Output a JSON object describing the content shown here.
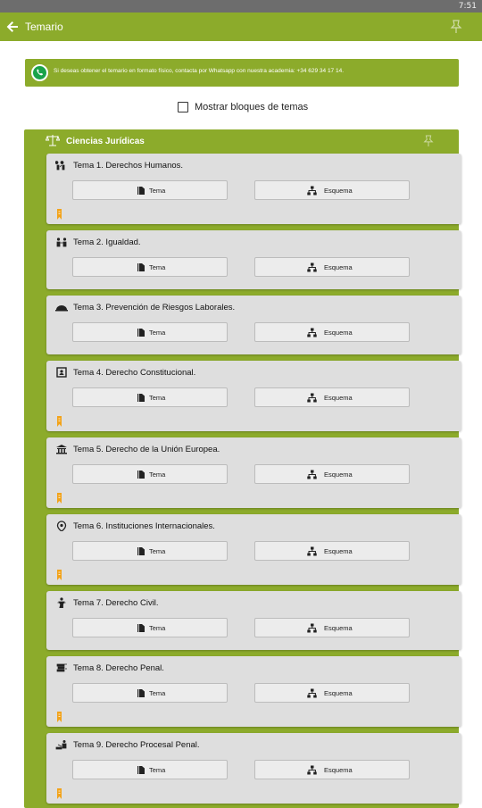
{
  "status": {
    "time": "7:51"
  },
  "appbar": {
    "title": "Temario",
    "back_icon": "arrow-left-icon",
    "pin_icon": "pin-icon"
  },
  "banner": {
    "text": "Si deseas obtener el temario en formato físico, contacta por Whatsapp con nuestra academia: +34 629 34 17 14.",
    "icon": "whatsapp-icon"
  },
  "toggle": {
    "label": "Mostrar bloques de temas",
    "checked": false
  },
  "block": {
    "title": "Ciencias Jurídicas",
    "icon": "scale-icon",
    "topics": [
      {
        "title": "Tema 1. Derechos Humanos.",
        "icon": "people-icon",
        "tema_label": "Tema",
        "esquema_label": "Esquema",
        "marked": true
      },
      {
        "title": "Tema 2. Igualdad.",
        "icon": "equality-icon",
        "tema_label": "Tema",
        "esquema_label": "Esquema",
        "marked": false
      },
      {
        "title": "Tema 3. Prevención de Riesgos Laborales.",
        "icon": "hardhat-icon",
        "tema_label": "Tema",
        "esquema_label": "Esquema",
        "marked": false
      },
      {
        "title": "Tema 4. Derecho Constitucional.",
        "icon": "book-icon",
        "tema_label": "Tema",
        "esquema_label": "Esquema",
        "marked": true
      },
      {
        "title": "Tema 5. Derecho de la Unión Europea.",
        "icon": "institution-icon",
        "tema_label": "Tema",
        "esquema_label": "Esquema",
        "marked": true
      },
      {
        "title": "Tema 6. Instituciones Internacionales.",
        "icon": "globe-pin-icon",
        "tema_label": "Tema",
        "esquema_label": "Esquema",
        "marked": true
      },
      {
        "title": "Tema 7. Derecho Civil.",
        "icon": "person-icon",
        "tema_label": "Tema",
        "esquema_label": "Esquema",
        "marked": false
      },
      {
        "title": "Tema 8. Derecho Penal.",
        "icon": "gavel-icon",
        "tema_label": "Tema",
        "esquema_label": "Esquema",
        "marked": true
      },
      {
        "title": "Tema 9. Derecho Procesal Penal.",
        "icon": "justice-icon",
        "tema_label": "Tema",
        "esquema_label": "Esquema",
        "marked": true
      }
    ]
  },
  "colors": {
    "primary": "#8cab2b",
    "card": "#dedede",
    "button": "#ececec",
    "mark": "#f2a31b",
    "whatsapp": "#1aa34a"
  }
}
